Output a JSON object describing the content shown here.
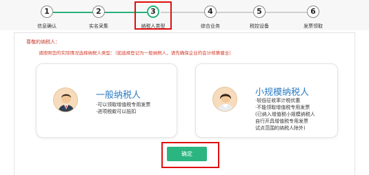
{
  "colors": {
    "accent": "#2bb580",
    "line_done": "#27b07a",
    "line_todo": "#cfcfcf",
    "highlight": "#e00d0d",
    "card_title": "#2a7bc2",
    "warning": "#d13a2a"
  },
  "steps": [
    {
      "number": "1",
      "label": "信息确认"
    },
    {
      "number": "2",
      "label": "实名采集"
    },
    {
      "number": "3",
      "label": "纳税人类型"
    },
    {
      "number": "4",
      "label": "综合业务"
    },
    {
      "number": "5",
      "label": "税控设备"
    },
    {
      "number": "6",
      "label": "发票领取"
    }
  ],
  "current_step": 3,
  "form": {
    "greeting": "尊敬的纳税人：",
    "notice": "请按照您的实际情况选择纳税人类型：（如选择登记为一般纳税人，请先确保企业的会计核算健全）"
  },
  "options": [
    {
      "title": "一般纳税人",
      "lines": [
        "·可以领取增值税专用发票",
        "·进项税款可以抵扣"
      ],
      "icon": "male-avatar-icon"
    },
    {
      "title": "小规模纳税人",
      "lines": [
        "·较低征收率计税优惠",
        "·不能领取增值税专用发票",
        "(已纳入增值税小规模纳税人",
        "自行开具增值税专用发票",
        "试点范围的纳税人除外)"
      ],
      "icon": "female-avatar-icon"
    }
  ],
  "confirm_label": "确定"
}
